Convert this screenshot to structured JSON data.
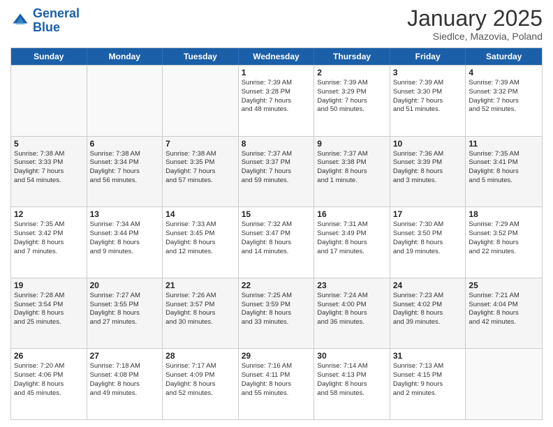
{
  "logo": {
    "line1": "General",
    "line2": "Blue"
  },
  "title": "January 2025",
  "subtitle": "Siedlce, Mazovia, Poland",
  "days": [
    "Sunday",
    "Monday",
    "Tuesday",
    "Wednesday",
    "Thursday",
    "Friday",
    "Saturday"
  ],
  "weeks": [
    [
      {
        "day": "",
        "info": ""
      },
      {
        "day": "",
        "info": ""
      },
      {
        "day": "",
        "info": ""
      },
      {
        "day": "1",
        "info": "Sunrise: 7:39 AM\nSunset: 3:28 PM\nDaylight: 7 hours\nand 48 minutes."
      },
      {
        "day": "2",
        "info": "Sunrise: 7:39 AM\nSunset: 3:29 PM\nDaylight: 7 hours\nand 50 minutes."
      },
      {
        "day": "3",
        "info": "Sunrise: 7:39 AM\nSunset: 3:30 PM\nDaylight: 7 hours\nand 51 minutes."
      },
      {
        "day": "4",
        "info": "Sunrise: 7:39 AM\nSunset: 3:32 PM\nDaylight: 7 hours\nand 52 minutes."
      }
    ],
    [
      {
        "day": "5",
        "info": "Sunrise: 7:38 AM\nSunset: 3:33 PM\nDaylight: 7 hours\nand 54 minutes."
      },
      {
        "day": "6",
        "info": "Sunrise: 7:38 AM\nSunset: 3:34 PM\nDaylight: 7 hours\nand 56 minutes."
      },
      {
        "day": "7",
        "info": "Sunrise: 7:38 AM\nSunset: 3:35 PM\nDaylight: 7 hours\nand 57 minutes."
      },
      {
        "day": "8",
        "info": "Sunrise: 7:37 AM\nSunset: 3:37 PM\nDaylight: 7 hours\nand 59 minutes."
      },
      {
        "day": "9",
        "info": "Sunrise: 7:37 AM\nSunset: 3:38 PM\nDaylight: 8 hours\nand 1 minute."
      },
      {
        "day": "10",
        "info": "Sunrise: 7:36 AM\nSunset: 3:39 PM\nDaylight: 8 hours\nand 3 minutes."
      },
      {
        "day": "11",
        "info": "Sunrise: 7:35 AM\nSunset: 3:41 PM\nDaylight: 8 hours\nand 5 minutes."
      }
    ],
    [
      {
        "day": "12",
        "info": "Sunrise: 7:35 AM\nSunset: 3:42 PM\nDaylight: 8 hours\nand 7 minutes."
      },
      {
        "day": "13",
        "info": "Sunrise: 7:34 AM\nSunset: 3:44 PM\nDaylight: 8 hours\nand 9 minutes."
      },
      {
        "day": "14",
        "info": "Sunrise: 7:33 AM\nSunset: 3:45 PM\nDaylight: 8 hours\nand 12 minutes."
      },
      {
        "day": "15",
        "info": "Sunrise: 7:32 AM\nSunset: 3:47 PM\nDaylight: 8 hours\nand 14 minutes."
      },
      {
        "day": "16",
        "info": "Sunrise: 7:31 AM\nSunset: 3:49 PM\nDaylight: 8 hours\nand 17 minutes."
      },
      {
        "day": "17",
        "info": "Sunrise: 7:30 AM\nSunset: 3:50 PM\nDaylight: 8 hours\nand 19 minutes."
      },
      {
        "day": "18",
        "info": "Sunrise: 7:29 AM\nSunset: 3:52 PM\nDaylight: 8 hours\nand 22 minutes."
      }
    ],
    [
      {
        "day": "19",
        "info": "Sunrise: 7:28 AM\nSunset: 3:54 PM\nDaylight: 8 hours\nand 25 minutes."
      },
      {
        "day": "20",
        "info": "Sunrise: 7:27 AM\nSunset: 3:55 PM\nDaylight: 8 hours\nand 27 minutes."
      },
      {
        "day": "21",
        "info": "Sunrise: 7:26 AM\nSunset: 3:57 PM\nDaylight: 8 hours\nand 30 minutes."
      },
      {
        "day": "22",
        "info": "Sunrise: 7:25 AM\nSunset: 3:59 PM\nDaylight: 8 hours\nand 33 minutes."
      },
      {
        "day": "23",
        "info": "Sunrise: 7:24 AM\nSunset: 4:00 PM\nDaylight: 8 hours\nand 36 minutes."
      },
      {
        "day": "24",
        "info": "Sunrise: 7:23 AM\nSunset: 4:02 PM\nDaylight: 8 hours\nand 39 minutes."
      },
      {
        "day": "25",
        "info": "Sunrise: 7:21 AM\nSunset: 4:04 PM\nDaylight: 8 hours\nand 42 minutes."
      }
    ],
    [
      {
        "day": "26",
        "info": "Sunrise: 7:20 AM\nSunset: 4:06 PM\nDaylight: 8 hours\nand 45 minutes."
      },
      {
        "day": "27",
        "info": "Sunrise: 7:18 AM\nSunset: 4:08 PM\nDaylight: 8 hours\nand 49 minutes."
      },
      {
        "day": "28",
        "info": "Sunrise: 7:17 AM\nSunset: 4:09 PM\nDaylight: 8 hours\nand 52 minutes."
      },
      {
        "day": "29",
        "info": "Sunrise: 7:16 AM\nSunset: 4:11 PM\nDaylight: 8 hours\nand 55 minutes."
      },
      {
        "day": "30",
        "info": "Sunrise: 7:14 AM\nSunset: 4:13 PM\nDaylight: 8 hours\nand 58 minutes."
      },
      {
        "day": "31",
        "info": "Sunrise: 7:13 AM\nSunset: 4:15 PM\nDaylight: 9 hours\nand 2 minutes."
      },
      {
        "day": "",
        "info": ""
      }
    ]
  ]
}
